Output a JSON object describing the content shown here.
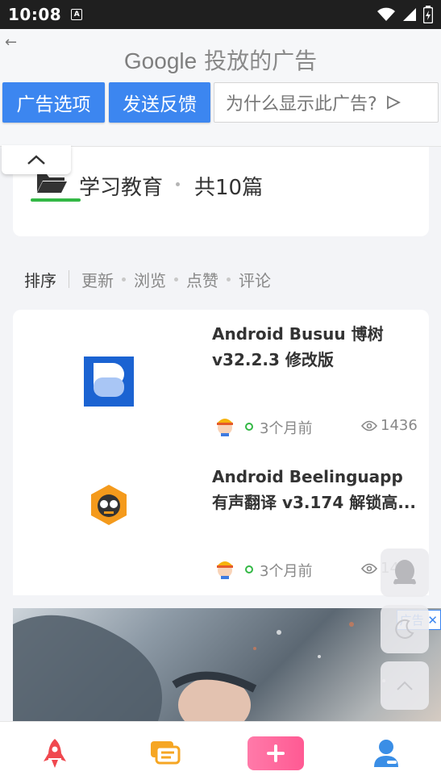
{
  "status_bar": {
    "time": "10:08",
    "a_badge": "A"
  },
  "ad_banner": {
    "google_word": "Google",
    "title_suffix": "投放的广告",
    "ad_options_label": "广告选项",
    "feedback_label": "发送反馈",
    "why_label": "为什么显示此广告?",
    "accent_color": "#3c86f0"
  },
  "category": {
    "name": "学习教育",
    "count": "共10篇"
  },
  "sort": {
    "label": "排序",
    "options": [
      "更新",
      "浏览",
      "点赞",
      "评论"
    ]
  },
  "list": [
    {
      "title": "Android Busuu 博树 v32.2.3 修改版",
      "time": "3个月前",
      "views": "1436",
      "icon": "busuu-app-icon"
    },
    {
      "title": "Android Beelinguapp 有声翻译 v3.174 解锁高...",
      "time": "3个月前",
      "views": "14",
      "icon": "beelinguapp-app-icon"
    }
  ],
  "bottom_ad": {
    "tag": "广告"
  },
  "nav": {
    "items": [
      "rocket-icon",
      "chat-icon",
      "plus-icon",
      "user-icon"
    ],
    "brand_pink": "#ff5a93"
  }
}
